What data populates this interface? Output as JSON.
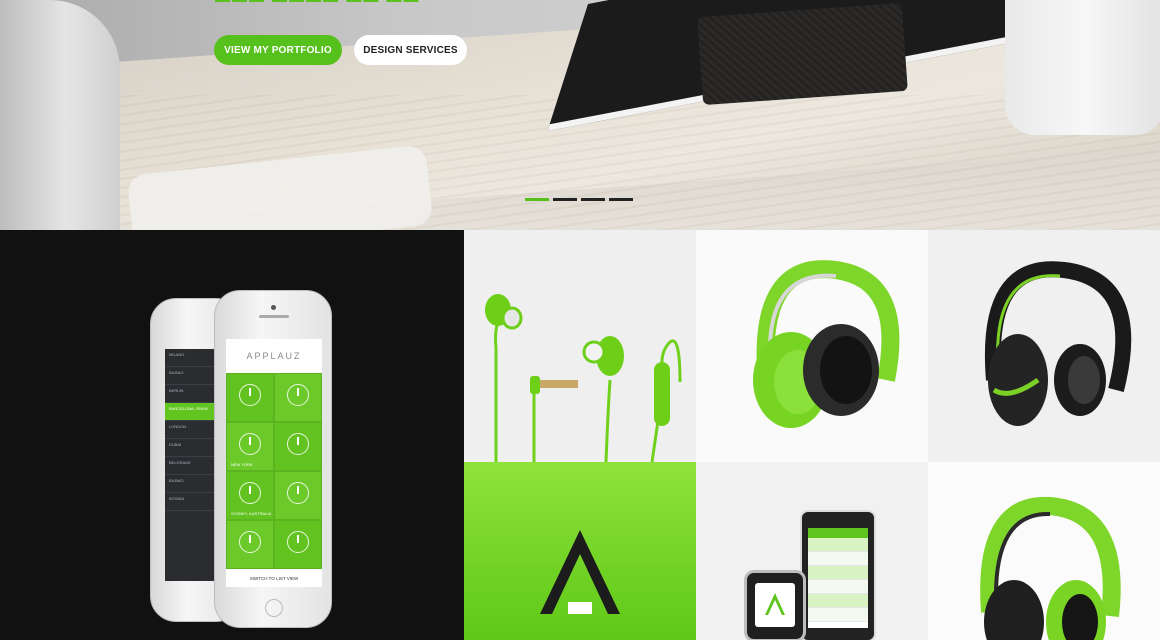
{
  "hero": {
    "buttons": {
      "primary": "VIEW MY PORTFOLIO",
      "secondary": "DESIGN SERVICES"
    },
    "slider": {
      "count": 4,
      "active_index": 0
    }
  },
  "colors": {
    "accent": "#56c01c",
    "dark": "#111111"
  },
  "portfolio": {
    "phone_app": {
      "name": "APPLAUZ",
      "footer": "SWITCH TO LIST VIEW",
      "cities": [
        "NEW YORK",
        "SYDNEY, AUSTRALIA"
      ],
      "list": [
        "MILANO",
        "BILBAO",
        "BERLIN",
        "BARCELONA, SPAIN",
        "LONDON",
        "DUBAI",
        "BELGRADE",
        "BILBAO",
        "BOSNIA"
      ]
    },
    "tiles": [
      {
        "subject": "earbuds"
      },
      {
        "subject": "green headphones"
      },
      {
        "subject": "black and green headphones"
      },
      {
        "subject": "logo mark"
      },
      {
        "subject": "smartphone and smartwatch"
      },
      {
        "subject": "headphones"
      }
    ]
  }
}
